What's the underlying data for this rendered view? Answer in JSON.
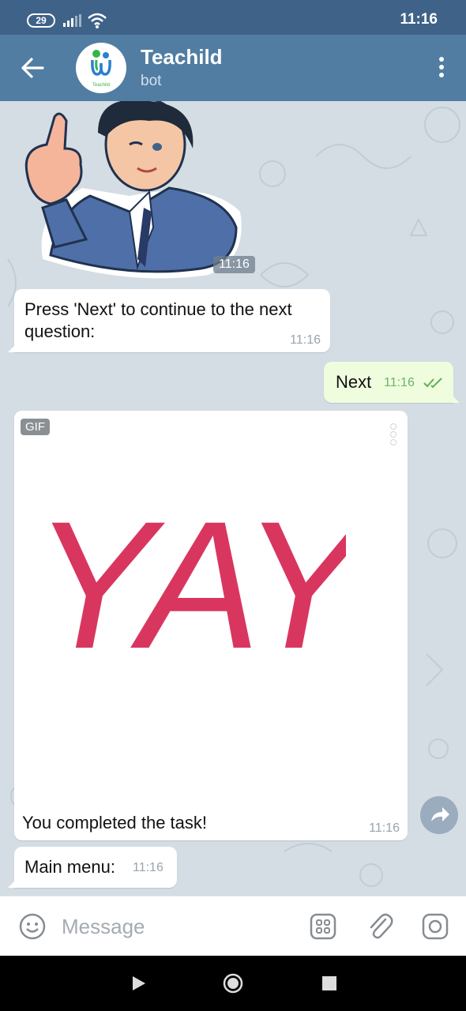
{
  "status_bar": {
    "battery": "29",
    "time": "11:16"
  },
  "header": {
    "title": "Teachild",
    "subtitle": "bot",
    "avatar_text": "Teachild"
  },
  "messages": {
    "sticker_time": "11:16",
    "prompt": {
      "text": "Press 'Next' to continue to the next question:",
      "time": "11:16"
    },
    "reply": {
      "text": "Next",
      "time": "11:16"
    },
    "gif": {
      "badge": "GIF",
      "image_text": "YAY",
      "caption": "You completed the task!",
      "time": "11:16"
    },
    "menu": {
      "text": "Main menu:",
      "time": "11:16"
    }
  },
  "input": {
    "placeholder": "Message"
  },
  "colors": {
    "header": "#517da2",
    "status": "#3f6388",
    "outgoing": "#effdde",
    "yay": "#d62552"
  }
}
